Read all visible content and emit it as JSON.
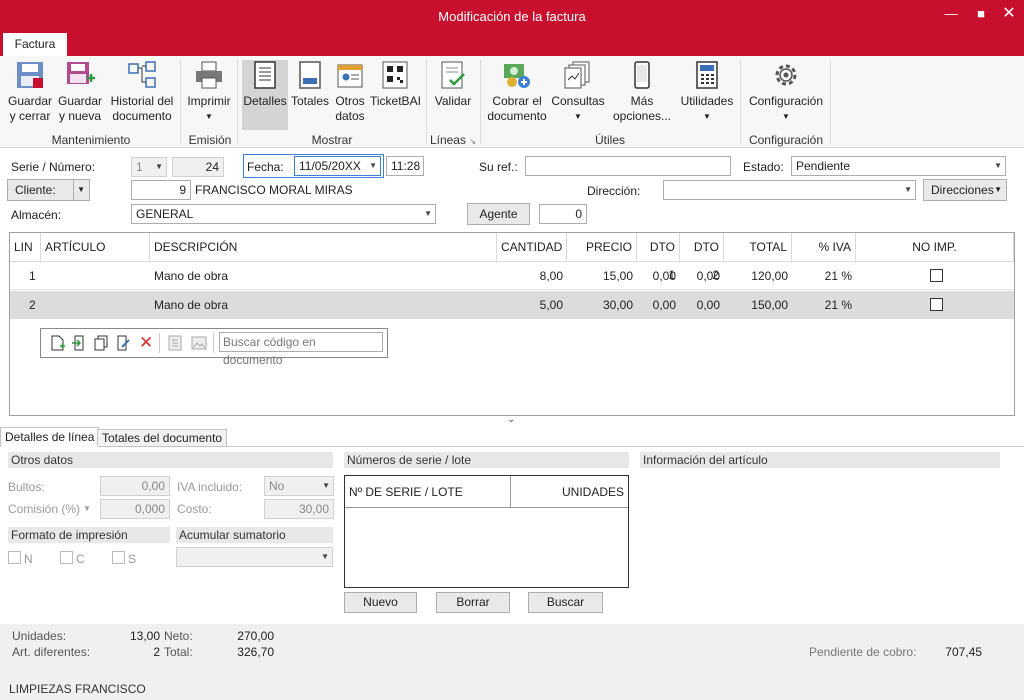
{
  "window": {
    "title": "Modificación de la factura"
  },
  "ribbon": {
    "tab": "Factura",
    "buttons": {
      "guardar_cerrar": "Guardar\ny cerrar",
      "guardar_nueva": "Guardar\ny nueva",
      "historial": "Historial del\ndocumento",
      "imprimir": "Imprimir",
      "detalles": "Detalles",
      "totales": "Totales",
      "otros": "Otros\ndatos",
      "ticketbai": "TicketBAI",
      "validar": "Validar",
      "cobrar": "Cobrar el\ndocumento",
      "consultas": "Consultas",
      "mas": "Más\nopciones...",
      "utilidades": "Utilidades",
      "configuracion": "Configuración"
    },
    "groups": {
      "mantenimiento": "Mantenimiento",
      "emision": "Emisión",
      "mostrar": "Mostrar",
      "lineas": "Líneas",
      "utiles": "Útiles",
      "configuracion": "Configuración"
    }
  },
  "header": {
    "serie_label": "Serie / Número:",
    "serie": "1",
    "numero": "24",
    "fecha_label": "Fecha:",
    "fecha": "11/05/20XX",
    "hora": "11:28",
    "suref_label": "Su ref.:",
    "suref": "",
    "estado_label": "Estado:",
    "estado": "Pendiente",
    "cliente_label": "Cliente:",
    "cliente_code": "9",
    "cliente_name": "FRANCISCO MORAL MIRAS",
    "direccion_label": "Dirección:",
    "direccion": "",
    "direcciones_btn": "Direcciones",
    "almacen_label": "Almacén:",
    "almacen": "GENERAL",
    "agente_btn": "Agente",
    "agente": "0"
  },
  "grid": {
    "columns": [
      "LIN",
      "ARTÍCULO",
      "DESCRIPCIÓN",
      "CANTIDAD",
      "PRECIO",
      "DTO 1",
      "DTO 2",
      "TOTAL",
      "% IVA",
      "NO IMP."
    ],
    "rows": [
      {
        "lin": "1",
        "articulo": "",
        "descripcion": "Mano de obra",
        "cantidad": "8,00",
        "precio": "15,00",
        "dto1": "0,00",
        "dto2": "0,00",
        "total": "120,00",
        "iva": "21 %"
      },
      {
        "lin": "2",
        "articulo": "",
        "descripcion": "Mano de obra",
        "cantidad": "5,00",
        "precio": "30,00",
        "dto1": "0,00",
        "dto2": "0,00",
        "total": "150,00",
        "iva": "21 %"
      }
    ],
    "search_placeholder": "Buscar código en documento"
  },
  "tabs": {
    "detalles": "Detalles de línea",
    "totales": "Totales del documento"
  },
  "otros": {
    "title": "Otros datos",
    "bultos_label": "Bultos:",
    "bultos": "0,00",
    "comision_label": "Comisión (%)",
    "comision": "0,000",
    "iva_label": "IVA incluido:",
    "iva": "No",
    "costo_label": "Costo:",
    "costo": "30,00",
    "formato_title": "Formato de impresión",
    "n": "N",
    "c": "C",
    "s": "S",
    "acumular_title": "Acumular sumatorio"
  },
  "series": {
    "title": "Números de serie / lote",
    "col1": "Nº DE SERIE / LOTE",
    "col2": "UNIDADES",
    "nuevo": "Nuevo",
    "borrar": "Borrar",
    "buscar": "Buscar"
  },
  "info": {
    "title": "Información del artículo"
  },
  "footer": {
    "unidades_label": "Unidades:",
    "unidades": "13,00",
    "art_label": "Art. diferentes:",
    "art": "2",
    "neto_label": "Neto:",
    "neto": "270,00",
    "total_label": "Total:",
    "total": "326,70",
    "pendiente_label": "Pendiente de cobro:",
    "pendiente": "707,45",
    "company": "LIMPIEZAS FRANCISCO"
  }
}
